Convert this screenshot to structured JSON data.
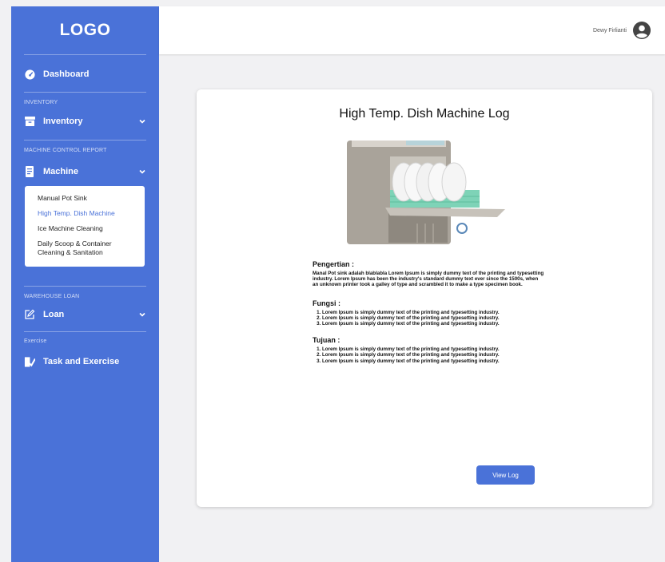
{
  "colors": {
    "primary": "#4a72d8",
    "background": "#f1f1f3",
    "active_link": "#4a72d8"
  },
  "sidebar": {
    "logo": "LOGO",
    "dashboard": {
      "label": "Dashboard",
      "icon": "speedometer-icon"
    },
    "inventory_section": "INVENTORY",
    "inventory": {
      "label": "Inventory",
      "icon": "archive-box-icon"
    },
    "machine_section": "MACHINE CONTROL REPORT",
    "machine": {
      "label": "Machine",
      "icon": "document-icon",
      "items": [
        {
          "label": "Manual Pot Sink",
          "active": false
        },
        {
          "label": "High Temp. Dish Machine",
          "active": true
        },
        {
          "label": "Ice Machine Cleaning",
          "active": false
        },
        {
          "label": "Daily Scoop & Container Cleaning & Sanitation",
          "active": false
        }
      ]
    },
    "warehouse_section": "WAREHOUSE LOAN",
    "loan": {
      "label": "Loan",
      "icon": "edit-icon"
    },
    "exercise_section": "Exercise",
    "task": {
      "label": "Task and Exercise",
      "icon": "tasks-icon"
    }
  },
  "header": {
    "user_name": "Dewy Firlianti",
    "avatar_icon": "user-circle-icon"
  },
  "main": {
    "title": "High Temp. Dish Machine Log",
    "pengertian_title": "Pengertian :",
    "pengertian_text": "Manal Pot sink adalah blablabla  Lorem Ipsum is simply dummy text of the printing and typesetting industry. Lorem Ipsum has been the industry's standard dummy text ever since the 1500s, when an unknown printer took a galley of type and scrambled it to make a type specimen book.",
    "fungsi_title": "Fungsi :",
    "fungsi_items": [
      "Lorem Ipsum is simply dummy text of the printing and typesetting industry.",
      "Lorem Ipsum is simply dummy text of the printing and typesetting industry.",
      "Lorem Ipsum is simply dummy text of the printing and typesetting industry."
    ],
    "tujuan_title": "Tujuan :",
    "tujuan_items": [
      "Lorem Ipsum is simply dummy text of the printing and typesetting industry.",
      "Lorem Ipsum is simply dummy text of the printing and typesetting industry.",
      "Lorem Ipsum is simply dummy text of the printing and typesetting industry."
    ],
    "view_button": "View Log"
  }
}
